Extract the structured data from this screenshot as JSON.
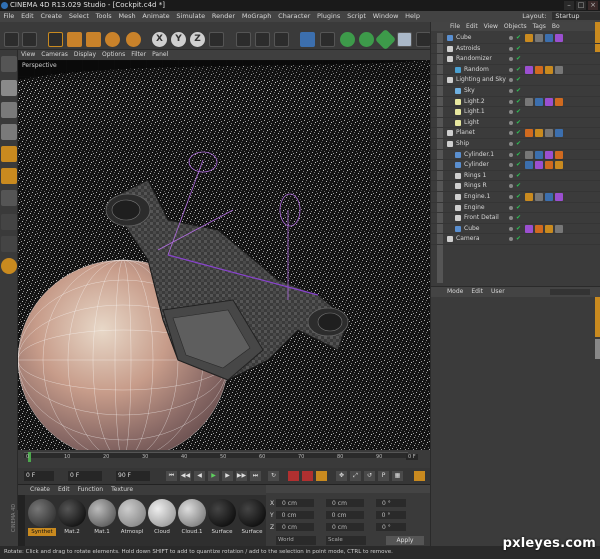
{
  "window": {
    "title": "CINEMA 4D R13.029 Studio - [Cockpit.c4d *]",
    "controls": [
      "–",
      "□",
      "×"
    ]
  },
  "menubar": {
    "items": [
      "File",
      "Edit",
      "Create",
      "Select",
      "Tools",
      "Mesh",
      "Animate",
      "Simulate",
      "Render",
      "MoGraph",
      "Character",
      "Plugins",
      "Script",
      "Window",
      "Help"
    ],
    "layout_label": "Layout:",
    "layout_value": "Startup"
  },
  "toolbar": {
    "axis_buttons": [
      "X",
      "Y",
      "Z"
    ]
  },
  "viewport": {
    "menu": [
      "View",
      "Cameras",
      "Display",
      "Options",
      "Filter",
      "Panel"
    ],
    "label": "Perspective"
  },
  "timeline": {
    "ticks": [
      "0",
      "10",
      "20",
      "30",
      "40",
      "50",
      "60",
      "70",
      "80",
      "90"
    ],
    "end_frame": "0 F"
  },
  "playbar": {
    "start_field": "0 F",
    "min_field": "0 F",
    "max_field": "90 F"
  },
  "materials": {
    "menu": [
      "Create",
      "Edit",
      "Function",
      "Texture"
    ],
    "swatches": [
      {
        "label": "Synthet",
        "selected": true
      },
      {
        "label": "Mat.2",
        "selected": false
      },
      {
        "label": "Mat.1",
        "selected": false
      },
      {
        "label": "Atmospl",
        "selected": false
      },
      {
        "label": "Cloud",
        "selected": false
      },
      {
        "label": "Cloud.1",
        "selected": false
      },
      {
        "label": "Surface",
        "selected": false
      },
      {
        "label": "Surface",
        "selected": false
      }
    ],
    "side_brand": "CINEMA 4D"
  },
  "coordinates": {
    "rows": [
      {
        "axis": "X",
        "a": "0 cm",
        "b": "0 cm",
        "c": "0 °"
      },
      {
        "axis": "Y",
        "a": "0 cm",
        "b": "0 cm",
        "c": "0 °"
      },
      {
        "axis": "Z",
        "a": "0 cm",
        "b": "0 cm",
        "c": "0 °"
      }
    ],
    "col_prefixes": [
      "X",
      "H"
    ],
    "mode_select": "World",
    "scale_select": "Scale",
    "apply_label": "Apply"
  },
  "objects": {
    "menu": [
      "File",
      "Edit",
      "View",
      "Objects",
      "Tags",
      "Bo"
    ],
    "rows": [
      {
        "name": "Cube",
        "indent": 0,
        "icon": "cube-icon"
      },
      {
        "name": "Astroids",
        "indent": 0,
        "icon": "null-icon"
      },
      {
        "name": "Randomizer",
        "indent": 0,
        "icon": "null-icon"
      },
      {
        "name": "Random",
        "indent": 1,
        "icon": "effector-icon"
      },
      {
        "name": "Lighting and Sky",
        "indent": 0,
        "icon": "null-icon"
      },
      {
        "name": "Sky",
        "indent": 1,
        "icon": "sky-icon"
      },
      {
        "name": "Light.2",
        "indent": 1,
        "icon": "light-icon"
      },
      {
        "name": "Light.1",
        "indent": 1,
        "icon": "light-icon"
      },
      {
        "name": "Light",
        "indent": 1,
        "icon": "light-icon"
      },
      {
        "name": "Planet",
        "indent": 0,
        "icon": "null-icon"
      },
      {
        "name": "Ship",
        "indent": 0,
        "icon": "null-icon"
      },
      {
        "name": "Cylinder.1",
        "indent": 1,
        "icon": "cylinder-icon"
      },
      {
        "name": "Cylinder",
        "indent": 1,
        "icon": "cylinder-icon"
      },
      {
        "name": "Rings 1",
        "indent": 1,
        "icon": "null-icon"
      },
      {
        "name": "Rings R",
        "indent": 1,
        "icon": "null-icon"
      },
      {
        "name": "Engine.1",
        "indent": 1,
        "icon": "null-icon"
      },
      {
        "name": "Engine",
        "indent": 1,
        "icon": "null-icon"
      },
      {
        "name": "Front Detail",
        "indent": 1,
        "icon": "null-icon"
      },
      {
        "name": "Cube",
        "indent": 1,
        "icon": "cube-icon"
      },
      {
        "name": "Camera",
        "indent": 0,
        "icon": "camera-icon"
      }
    ]
  },
  "attributes": {
    "menu": [
      "Mode",
      "Edit",
      "User"
    ]
  },
  "status": {
    "text": "Rotate: Click and drag to rotate elements. Hold down SHIFT to add to quantize rotation / add to the selection in point mode, CTRL to remove."
  },
  "watermark": "pxleyes.com",
  "colors": {
    "accent_orange": "#c98a1f",
    "selection_green": "#2fbf55",
    "icon_blue": "#3c6fae"
  }
}
